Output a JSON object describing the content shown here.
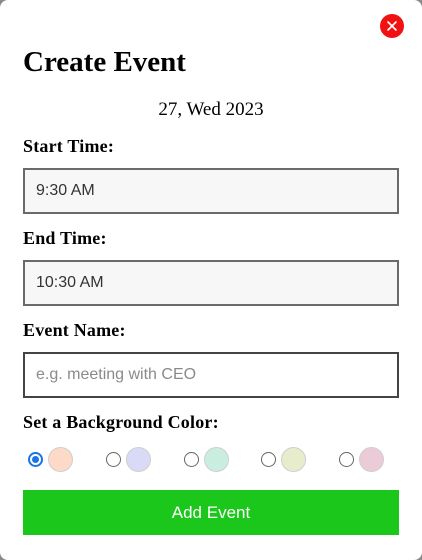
{
  "dialog": {
    "title": "Create Event",
    "date": "27, Wed 2023",
    "close_icon": "close-x-icon",
    "close_color": "#f01212"
  },
  "start_time": {
    "label": "Start Time:",
    "value": "9:30 AM"
  },
  "end_time": {
    "label": "End Time:",
    "value": "10:30 AM"
  },
  "event_name": {
    "label": "Event Name:",
    "value": "",
    "placeholder": "e.g. meeting with CEO"
  },
  "background_color": {
    "label": "Set a Background Color:",
    "selected_index": 0,
    "options": [
      {
        "color": "#fdd9c8",
        "selected": true
      },
      {
        "color": "#d9dbf6",
        "selected": false
      },
      {
        "color": "#c9eedf",
        "selected": false
      },
      {
        "color": "#e7edcc",
        "selected": false
      },
      {
        "color": "#eccbd9",
        "selected": false
      }
    ]
  },
  "submit": {
    "label": "Add Event",
    "color": "#1ac71a"
  }
}
